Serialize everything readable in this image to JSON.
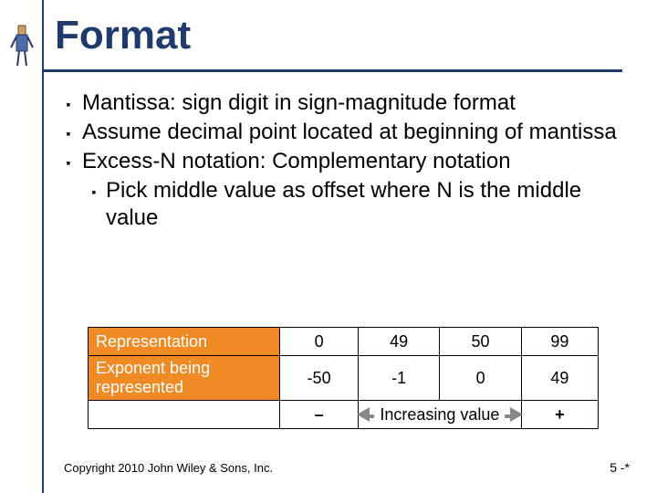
{
  "title": "Format",
  "bullets": [
    "Mantissa: sign digit in sign-magnitude format",
    "Assume decimal point located at beginning of mantissa",
    "Excess-N notation: Complementary notation"
  ],
  "sub_bullet": "Pick middle value as offset where N is the middle value",
  "table": {
    "row1_label": "Representation",
    "row1_vals": [
      "0",
      "49",
      "50",
      "99"
    ],
    "row2_label": "Exponent being represented",
    "row2_vals": [
      "-50",
      "-1",
      "0",
      "49"
    ],
    "minus": "–",
    "plus": "+",
    "increasing": "Increasing value"
  },
  "footer_left": "Copyright 2010 John Wiley & Sons, Inc.",
  "footer_right": "5 -*",
  "bullet_glyph": "▪",
  "chart_data": {
    "type": "table",
    "title": "Excess-N exponent representation mapping",
    "columns": [
      "Representation",
      "Exponent being represented"
    ],
    "rows": [
      {
        "Representation": 0,
        "Exponent being represented": -50
      },
      {
        "Representation": 49,
        "Exponent being represented": -1
      },
      {
        "Representation": 50,
        "Exponent being represented": 0
      },
      {
        "Representation": 99,
        "Exponent being represented": 49
      }
    ],
    "annotation": "Increasing value from – to +"
  }
}
